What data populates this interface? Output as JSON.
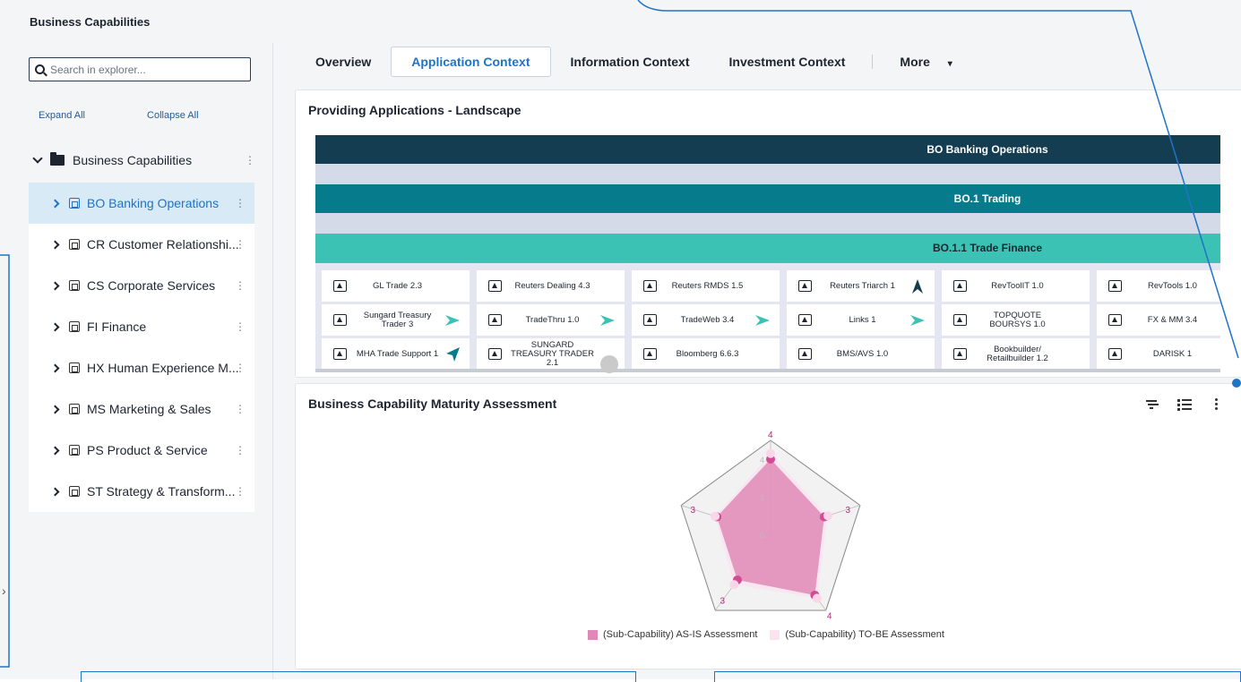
{
  "page": {
    "title": "Business Capabilities"
  },
  "explorer": {
    "search_placeholder": "Search in explorer...",
    "expand_all": "Expand All",
    "collapse_all": "Collapse All",
    "root_label": "Business Capabilities",
    "items": [
      {
        "label": "BO Banking Operations"
      },
      {
        "label": "CR Customer Relationshi..."
      },
      {
        "label": "CS Corporate Services"
      },
      {
        "label": "FI Finance"
      },
      {
        "label": "HX Human Experience M..."
      },
      {
        "label": "MS Marketing & Sales"
      },
      {
        "label": "PS Product & Service"
      },
      {
        "label": "ST Strategy & Transform..."
      }
    ],
    "selected_index": 0
  },
  "tabs": [
    {
      "label": "Overview"
    },
    {
      "label": "Application Context"
    },
    {
      "label": "Information Context"
    },
    {
      "label": "Investment Context"
    },
    {
      "label": "More"
    }
  ],
  "landscape": {
    "title": "Providing Applications - Landscape",
    "level1": "BO Banking Operations",
    "level2": "BO.1 Trading",
    "level3": "BO.1.1 Trade Finance",
    "apps": [
      {
        "name": "GL Trade 2.3",
        "trend": "down",
        "color": "#c8374a"
      },
      {
        "name": "Reuters Dealing 4.3",
        "trend": "down",
        "color": "#c8374a"
      },
      {
        "name": "Reuters RMDS 1.5",
        "trend": "down",
        "color": "#c8374a"
      },
      {
        "name": "Reuters Triarch 1",
        "trend": "up",
        "color": "#153d52"
      },
      {
        "name": "RevToolIT 1.0",
        "trend": "down",
        "color": "#c8374a"
      },
      {
        "name": "RevTools 1.0",
        "trend": "",
        "color": ""
      },
      {
        "name": "Sungard Treasury Trader 3",
        "trend": "right",
        "color": "#3cc2b5"
      },
      {
        "name": "TradeThru 1.0",
        "trend": "right",
        "color": "#3cc2b5"
      },
      {
        "name": "TradeWeb 3.4",
        "trend": "right",
        "color": "#3cc2b5"
      },
      {
        "name": "Links 1",
        "trend": "right",
        "color": "#3cc2b5"
      },
      {
        "name": "TOPQUOTE BOURSYS 1.0",
        "trend": "down",
        "color": "#c8374a"
      },
      {
        "name": "FX & MM 3.4",
        "trend": "down",
        "color": "#c8374a"
      },
      {
        "name": "MHA Trade Support 1",
        "trend": "up-right",
        "color": "#067b8b"
      },
      {
        "name": "SUNGARD TREASURY TRADER 2.1",
        "trend": "",
        "color": ""
      },
      {
        "name": "Bloomberg 6.6.3",
        "trend": "down",
        "color": "#c8374a"
      },
      {
        "name": "BMS/AVS 1.0",
        "trend": "down",
        "color": "#c8374a"
      },
      {
        "name": "Bookbuilder/ Retailbuilder 1.2",
        "trend": "down",
        "color": "#c8374a"
      },
      {
        "name": "DARISK 1",
        "trend": "down",
        "color": "#c8374a"
      }
    ]
  },
  "maturity": {
    "title": "Business Capability Maturity Assessment",
    "legend": [
      {
        "label": "(Sub-Capability) AS-IS Assessment",
        "color": "#e089b7"
      },
      {
        "label": "(Sub-Capability) TO-BE Assessment",
        "color": "#fbe3ef"
      }
    ],
    "chart_data": {
      "type": "radar",
      "axis_count": 5,
      "scale_ticks": [
        "0",
        "2",
        "4"
      ],
      "max": 5,
      "series": [
        {
          "name": "(Sub-Capability) AS-IS Assessment",
          "values": [
            4,
            3,
            4,
            3,
            3
          ],
          "color": "#e089b7"
        },
        {
          "name": "(Sub-Capability) TO-BE Assessment",
          "values": [
            4.3,
            3.2,
            4.2,
            3.3,
            3.1
          ],
          "color": "#fbe3ef"
        }
      ],
      "point_labels": [
        "4",
        "3",
        "4",
        "3",
        "3"
      ]
    }
  }
}
